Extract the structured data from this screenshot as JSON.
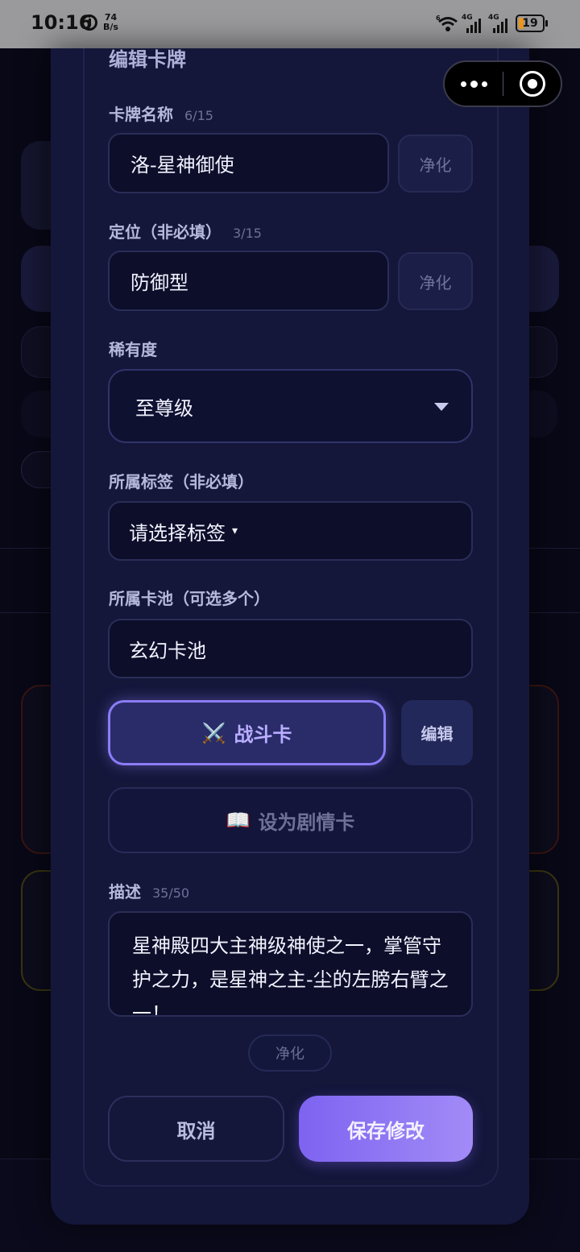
{
  "status_bar": {
    "time": "10:16",
    "net_speed_value": "74",
    "net_speed_unit": "B/s",
    "wifi_badge": "6",
    "sim1": "4G",
    "sim2": "4G",
    "battery_level": "19",
    "battery_color": "#f29a1a"
  },
  "modal": {
    "title": "编辑卡牌",
    "name_field": {
      "label": "卡牌名称",
      "count": "6/15",
      "value": "洛-星神御使",
      "purify_label": "净化"
    },
    "position_field": {
      "label": "定位（非必填）",
      "count": "3/15",
      "value": "防御型",
      "purify_label": "净化"
    },
    "rarity_field": {
      "label": "稀有度",
      "value": "至尊级"
    },
    "tag_field": {
      "label": "所属标签（非必填）",
      "placeholder": "请选择标签"
    },
    "pool_field": {
      "label": "所属卡池（可选多个）",
      "value": "玄幻卡池"
    },
    "card_type": {
      "battle_icon": "⚔️",
      "battle_label": "战斗卡",
      "edit_label": "编辑",
      "story_icon": "📖",
      "story_label": "设为剧情卡"
    },
    "description_field": {
      "label": "描述",
      "count": "35/50",
      "value": "星神殿四大主神级神使之一，掌管守护之力，是星神之主-尘的左膀右臂之一！",
      "purify_label": "净化"
    },
    "actions": {
      "cancel_label": "取消",
      "save_label": "保存修改"
    },
    "accent_color": "#8b7cf6"
  },
  "capsule": {
    "more_icon": "more-dots-icon",
    "close_icon": "target-circle-icon"
  }
}
